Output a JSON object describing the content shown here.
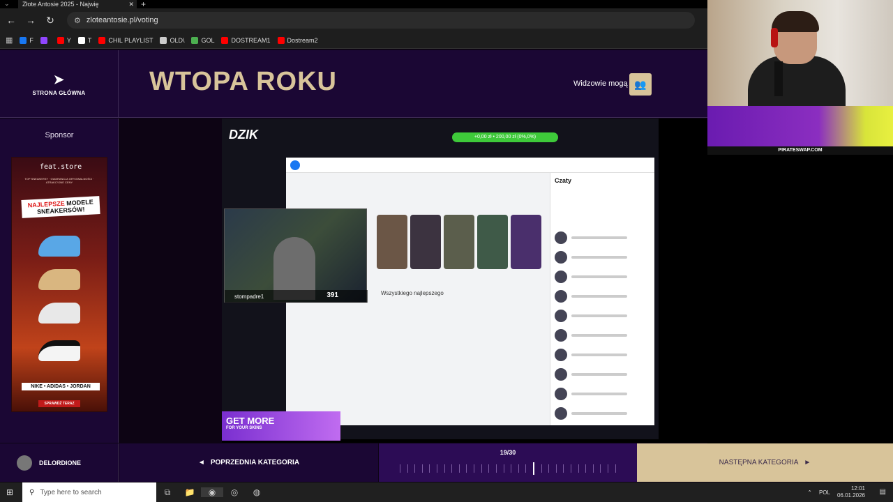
{
  "browser": {
    "tab_title": "Złote Antosie 2025 - Najwię",
    "url": "zloteantosie.pl/voting",
    "bookmarks": [
      {
        "label": "F",
        "color": "#1877f2"
      },
      {
        "label": "",
        "color": "#9146ff"
      },
      {
        "label": "Y",
        "color": "#ff0000"
      },
      {
        "label": "T",
        "color": "#ffffff"
      },
      {
        "label": "CHIL PLAYLIST",
        "color": "#ff0000"
      },
      {
        "label": "OLD\\",
        "color": "#cccccc"
      },
      {
        "label": "GOL",
        "color": "#4caf50"
      },
      {
        "label": "DOSTREAM1",
        "color": "#ff0000"
      },
      {
        "label": "Dostream2",
        "color": "#ff0000"
      }
    ]
  },
  "header": {
    "home_label": "STRONA GŁÓWNA",
    "category_title": "WTOPA ROKU",
    "viewers_label": "Widzowie mogą"
  },
  "sidebar": {
    "sponsor_label": "Sponsor",
    "ad": {
      "store": "feat.store",
      "tagline": "TOP SNEAKERSY · GWARANCJA ORYGINALNOŚCI · ATRAKCYJNE CENY",
      "headline_1": "NAJLEPSZE",
      "headline_2": "MODELE",
      "headline_3": "SNEAKERSÓW!",
      "brands": "NIKE • ADIDAS • JORDAN",
      "cta": "SPRAWDŹ TERAZ"
    }
  },
  "video": {
    "dzik": "DZIK",
    "green_bar": "+0,00 zł • 200,00 zł (0%,0%)",
    "chat_title": "Czaty",
    "post_text": "Wszystkiego najlepszego",
    "streamer_name": "stompadre1",
    "viewer_count": "391",
    "ad_title": "GET MORE",
    "ad_sub": "FOR YOUR SKINS"
  },
  "footer": {
    "profile_name": "DELORDIONE",
    "prev_label": "POPRZEDNIA KATEGORIA",
    "progress_label": "19/30",
    "progress_current": 19,
    "progress_total": 30,
    "next_label": "NASTĘPNA KATEGORIA"
  },
  "overlay": {
    "banner_url": "PIRATESWAP.COM"
  },
  "taskbar": {
    "search_placeholder": "Type here to search",
    "language": "POL",
    "time": "12:01",
    "date": "06.01.2026"
  }
}
